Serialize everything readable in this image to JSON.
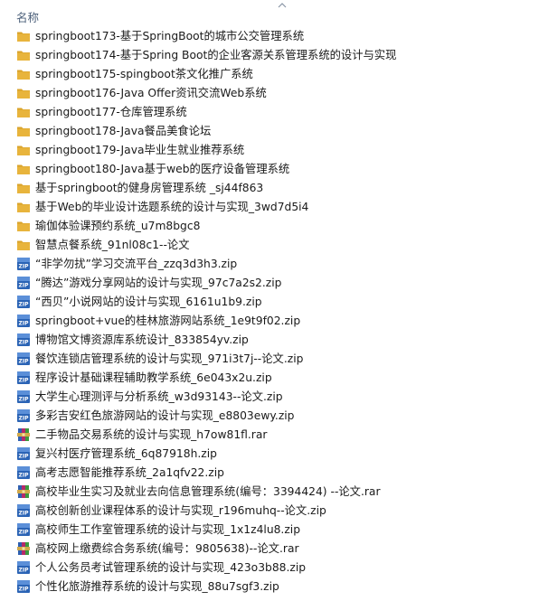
{
  "header": {
    "name_label": "名称"
  },
  "icons": {
    "folder": "folder-icon",
    "zip": "zip-archive-icon",
    "rar": "rar-archive-icon"
  },
  "colors": {
    "folder": "#e8b43c",
    "zip": "#2a63b5",
    "header_text": "#4c607a"
  },
  "files": [
    {
      "name": "springboot173-基于SpringBoot的城市公交管理系统",
      "type": "folder"
    },
    {
      "name": "springboot174-基于Spring Boot的企业客源关系管理系统的设计与实现",
      "type": "folder"
    },
    {
      "name": "springboot175-spingboot茶文化推广系统",
      "type": "folder"
    },
    {
      "name": "springboot176-Java Offer资讯交流Web系统",
      "type": "folder"
    },
    {
      "name": "springboot177-仓库管理系统",
      "type": "folder"
    },
    {
      "name": "springboot178-Java餐品美食论坛",
      "type": "folder"
    },
    {
      "name": "springboot179-Java毕业生就业推荐系统",
      "type": "folder"
    },
    {
      "name": "springboot180-Java基于web的医疗设备管理系统",
      "type": "folder"
    },
    {
      "name": "基于springboot的健身房管理系统 _sj44f863",
      "type": "folder"
    },
    {
      "name": "基于Web的毕业设计选题系统的设计与实现_3wd7d5i4",
      "type": "folder"
    },
    {
      "name": "瑜伽体验课预约系统_u7m8bgc8",
      "type": "folder"
    },
    {
      "name": "智慧点餐系统_91nl08c1--论文",
      "type": "folder"
    },
    {
      "name": "“非学勿扰”学习交流平台_zzq3d3h3.zip",
      "type": "zip"
    },
    {
      "name": "“腾达”游戏分享网站的设计与实现_97c7a2s2.zip",
      "type": "zip"
    },
    {
      "name": "“西贝”小说网站的设计与实现_6161u1b9.zip",
      "type": "zip"
    },
    {
      "name": "springboot+vue的桂林旅游网站系统_1e9t9f02.zip",
      "type": "zip"
    },
    {
      "name": "博物馆文博资源库系统设计_833854yv.zip",
      "type": "zip"
    },
    {
      "name": "餐饮连锁店管理系统的设计与实现_971i3t7j--论文.zip",
      "type": "zip"
    },
    {
      "name": "程序设计基础课程辅助教学系统_6e043x2u.zip",
      "type": "zip"
    },
    {
      "name": "大学生心理测评与分析系统_w3d93143--论文.zip",
      "type": "zip"
    },
    {
      "name": "多彩吉安红色旅游网站的设计与实现_e8803ewy.zip",
      "type": "zip"
    },
    {
      "name": "二手物品交易系统的设计与实现_h7ow81fl.rar",
      "type": "rar"
    },
    {
      "name": "复兴村医疗管理系统_6q87918h.zip",
      "type": "zip"
    },
    {
      "name": "高考志愿智能推荐系统_2a1qfv22.zip",
      "type": "zip"
    },
    {
      "name": "高校毕业生实习及就业去向信息管理系统(编号：3394424) --论文.rar",
      "type": "rar"
    },
    {
      "name": "高校创新创业课程体系的设计与实现_r196muhq--论文.zip",
      "type": "zip"
    },
    {
      "name": "高校师生工作室管理系统的设计与实现_1x1z4lu8.zip",
      "type": "zip"
    },
    {
      "name": "高校网上缴费综合务系统(编号：9805638)--论文.rar",
      "type": "rar"
    },
    {
      "name": "个人公务员考试管理系统的设计与实现_423o3b88.zip",
      "type": "zip"
    },
    {
      "name": "个性化旅游推荐系统的设计与实现_88u7sgf3.zip",
      "type": "zip"
    }
  ]
}
